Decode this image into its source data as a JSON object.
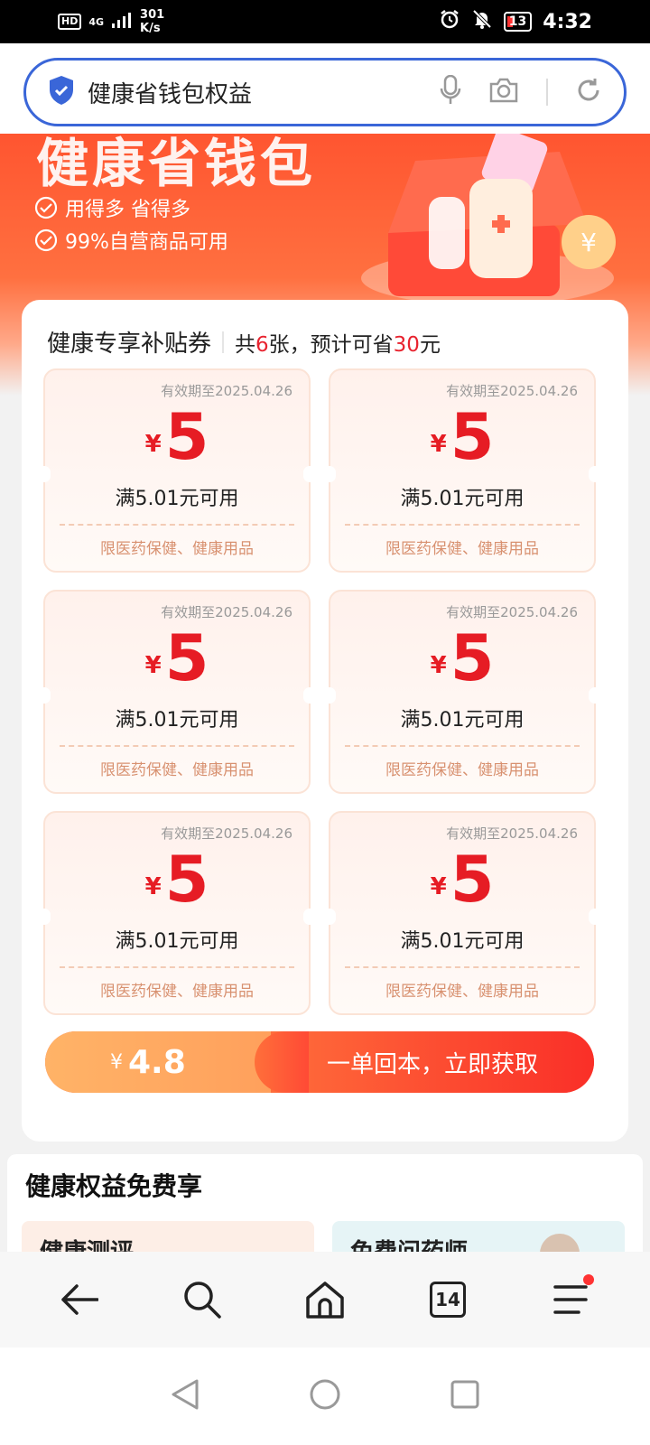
{
  "status_bar": {
    "hd": "HD",
    "network": "4G",
    "speed_value": "301",
    "speed_unit": "K/s",
    "battery": "13",
    "time": "4:32",
    "icons": [
      "alarm-icon",
      "mute-icon",
      "battery-icon",
      "signal-icon"
    ]
  },
  "search": {
    "query": "健康省钱包权益",
    "icons": [
      "shield-icon",
      "mic-icon",
      "camera-icon",
      "refresh-icon"
    ]
  },
  "banner": {
    "title": "健康省钱包",
    "points": [
      "用得多 省得多",
      "99%自营商品可用"
    ]
  },
  "coupons_section": {
    "title": "健康专享补贴券",
    "summary_prefix": "共",
    "count": "6",
    "summary_mid": "张，预计可省",
    "save_amount": "30",
    "summary_suffix": "元",
    "items": [
      {
        "valid": "有效期至2025.04.26",
        "yen": "¥",
        "amount": "5",
        "condition": "满5.01元可用",
        "scope": "限医药保健、健康用品"
      },
      {
        "valid": "有效期至2025.04.26",
        "yen": "¥",
        "amount": "5",
        "condition": "满5.01元可用",
        "scope": "限医药保健、健康用品"
      },
      {
        "valid": "有效期至2025.04.26",
        "yen": "¥",
        "amount": "5",
        "condition": "满5.01元可用",
        "scope": "限医药保健、健康用品"
      },
      {
        "valid": "有效期至2025.04.26",
        "yen": "¥",
        "amount": "5",
        "condition": "满5.01元可用",
        "scope": "限医药保健、健康用品"
      },
      {
        "valid": "有效期至2025.04.26",
        "yen": "¥",
        "amount": "5",
        "condition": "满5.01元可用",
        "scope": "限医药保健、健康用品"
      },
      {
        "valid": "有效期至2025.04.26",
        "yen": "¥",
        "amount": "5",
        "condition": "满5.01元可用",
        "scope": "限医药保健、健康用品"
      }
    ]
  },
  "cta": {
    "yen": "¥",
    "price": "4.8",
    "label": "一单回本，立即获取"
  },
  "benefits": {
    "title": "健康权益免费享",
    "cards": [
      "健康测评",
      "免费问药师"
    ]
  },
  "bottom_nav": {
    "tab_count": "14",
    "items": [
      "back-icon",
      "search-icon",
      "home-icon",
      "tabs-icon",
      "menu-icon"
    ]
  },
  "colors": {
    "accent_red": "#e61c24",
    "search_border": "#3a66d8",
    "cta_orange": "#ffa05c"
  }
}
